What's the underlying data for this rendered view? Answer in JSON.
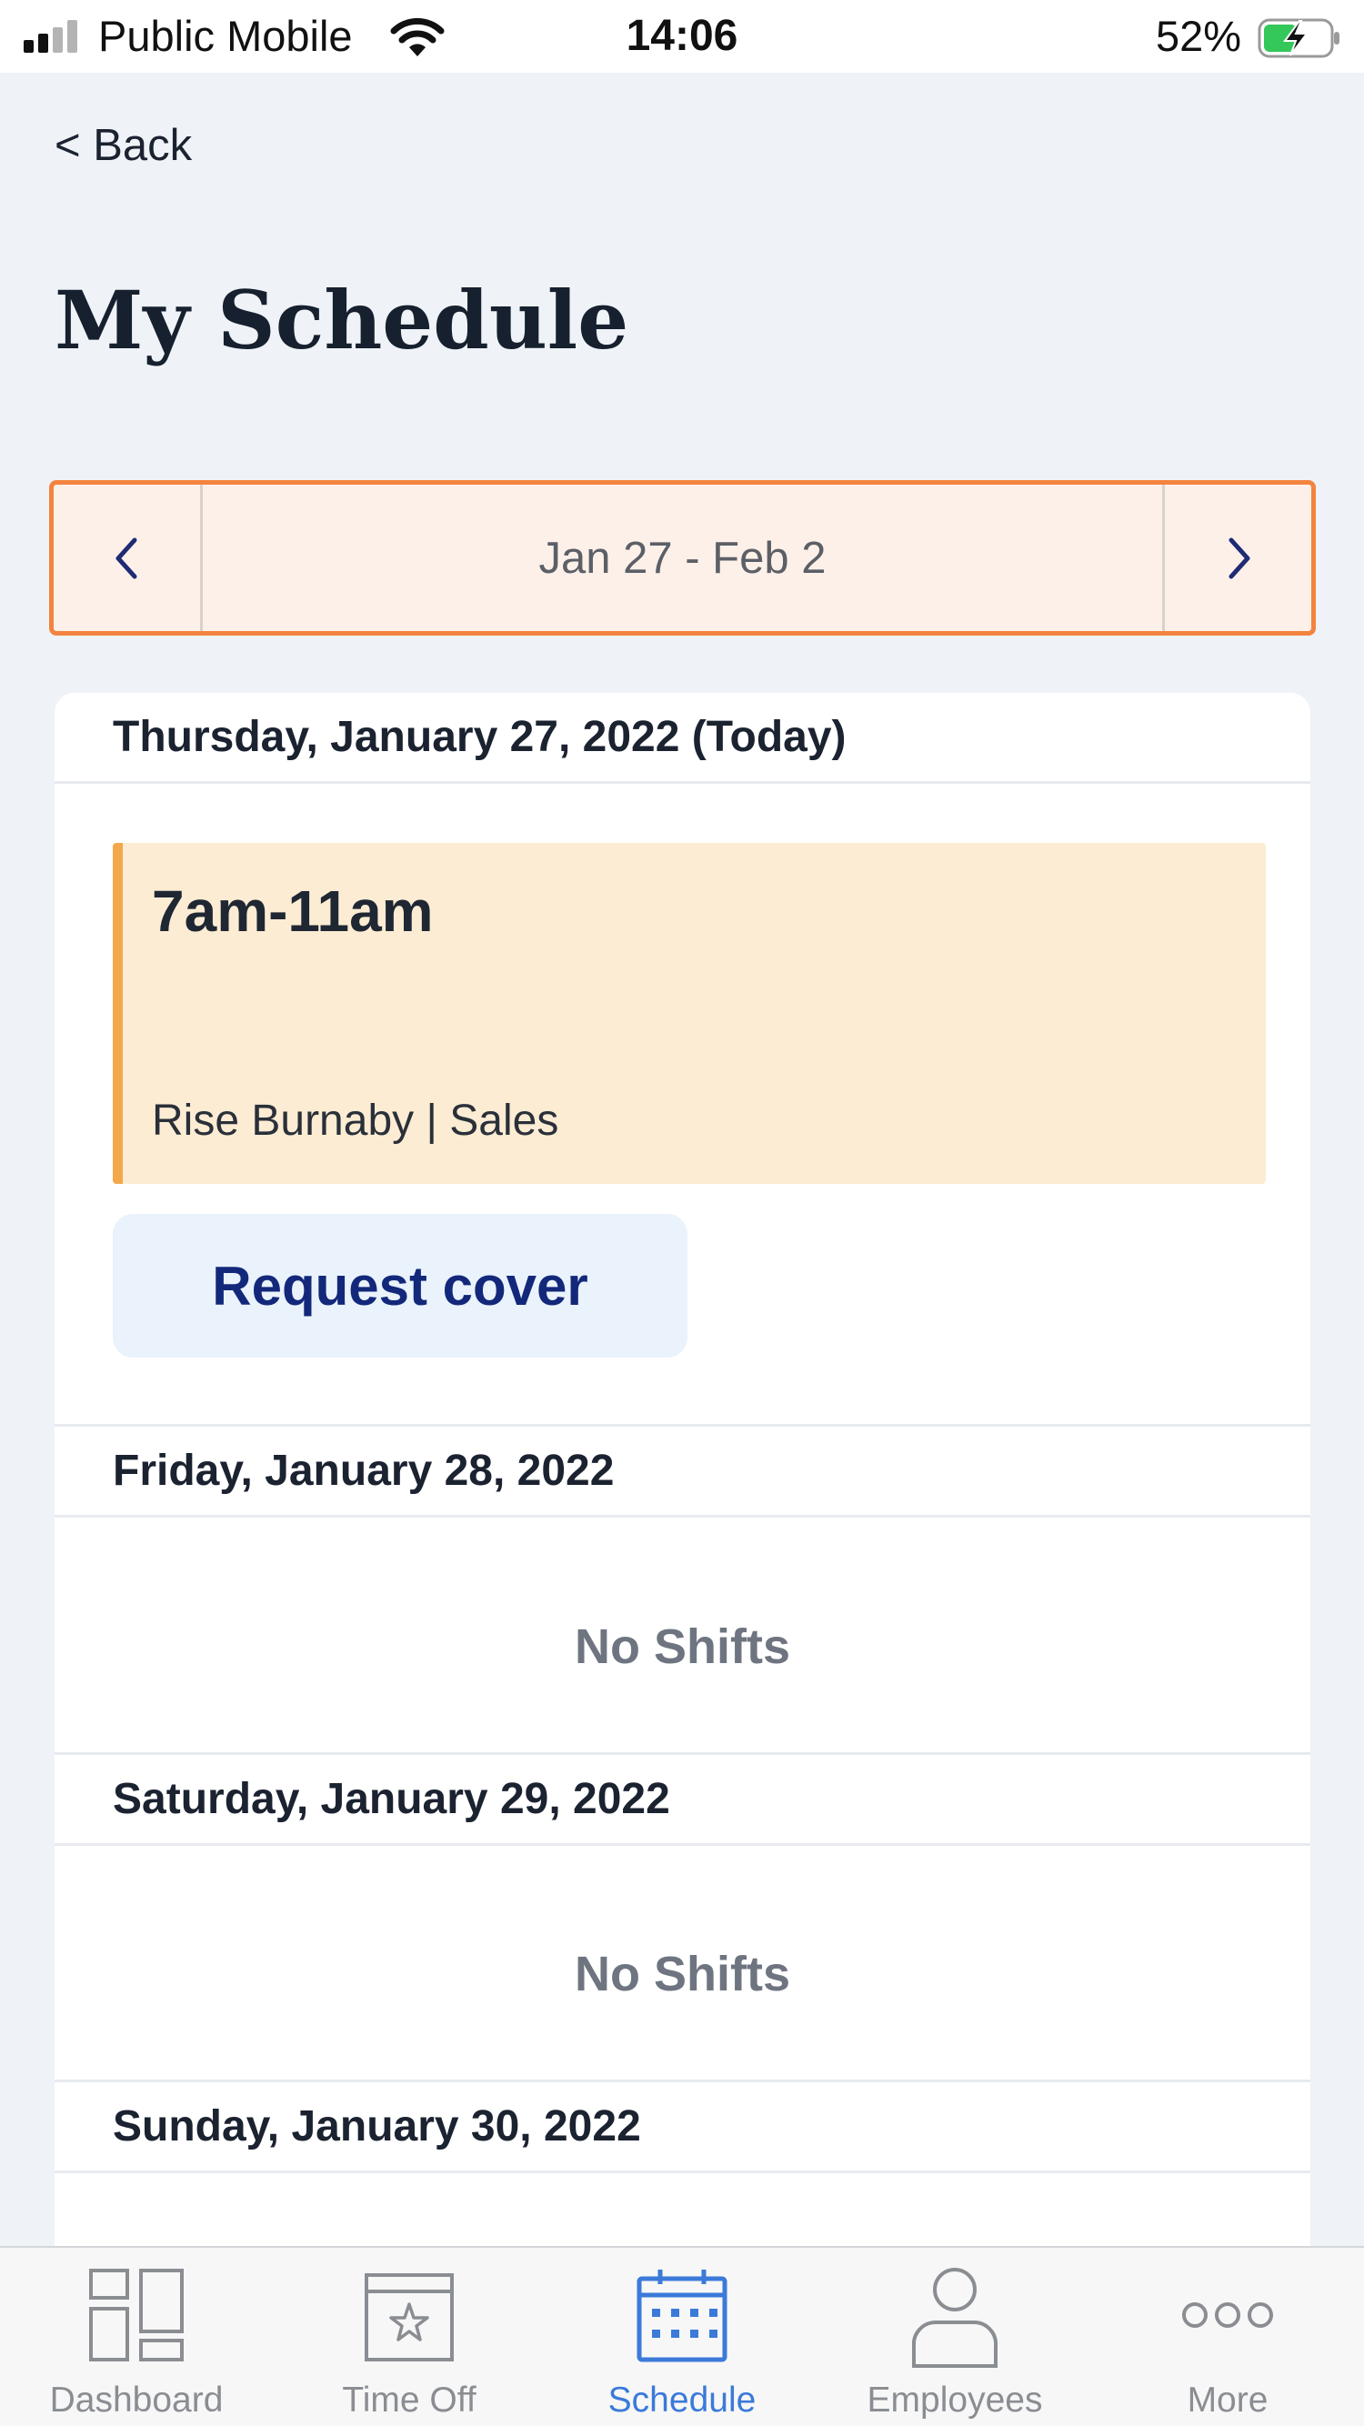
{
  "status_bar": {
    "carrier": "Public Mobile",
    "time": "14:06",
    "battery_percent": "52%",
    "signal_bars": 2,
    "battery_level": 0.52,
    "charging": true
  },
  "header": {
    "back_label": "< Back",
    "title": "My Schedule"
  },
  "week_nav": {
    "range": "Jan 27 - Feb 2",
    "prev_icon": "chevron-left-icon",
    "next_icon": "chevron-right-icon"
  },
  "days": [
    {
      "label": "Thursday, January 27, 2022 (Today)",
      "shift": {
        "time": "7am-11am",
        "location": "Rise Burnaby | Sales"
      },
      "action_label": "Request cover"
    },
    {
      "label": "Friday, January 28, 2022",
      "empty_text": "No Shifts"
    },
    {
      "label": "Saturday, January 29, 2022",
      "empty_text": "No Shifts"
    },
    {
      "label": "Sunday, January 30, 2022"
    }
  ],
  "tab_bar": {
    "tabs": [
      {
        "label": "Dashboard",
        "icon": "dashboard-icon",
        "active": false
      },
      {
        "label": "Time Off",
        "icon": "time-off-icon",
        "active": false
      },
      {
        "label": "Schedule",
        "icon": "calendar-icon",
        "active": true
      },
      {
        "label": "Employees",
        "icon": "person-icon",
        "active": false
      },
      {
        "label": "More",
        "icon": "more-icon",
        "active": false
      }
    ]
  },
  "colors": {
    "accent_orange": "#f3843f",
    "shift_bar": "#f3a84c",
    "shift_bg": "#fcecd3",
    "active_tab": "#3b7ad9",
    "button_text": "#13287a"
  }
}
